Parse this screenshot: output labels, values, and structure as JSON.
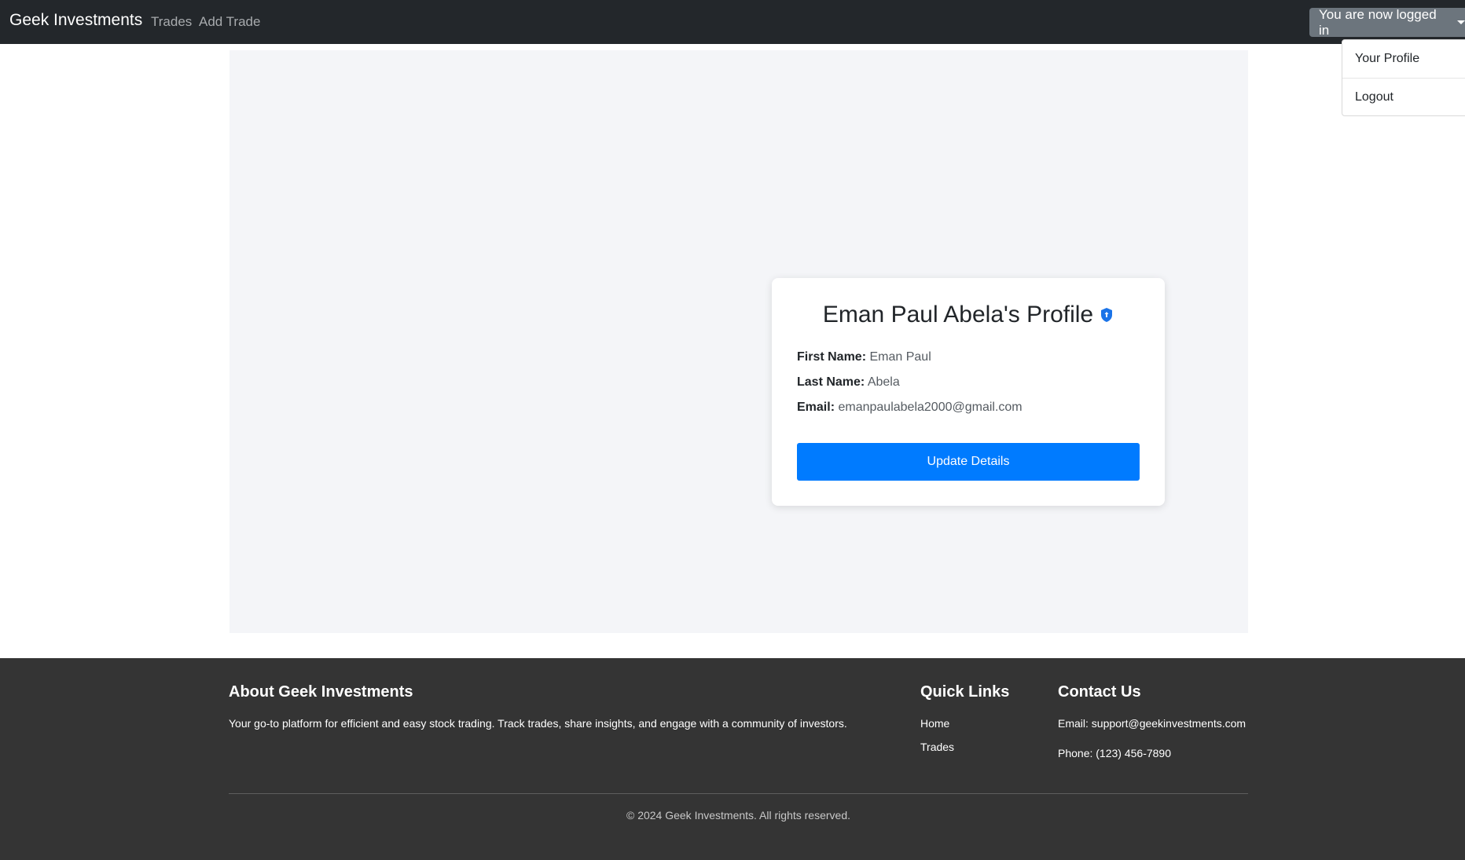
{
  "navbar": {
    "brand": "Geek Investments",
    "links": [
      {
        "label": "Trades"
      },
      {
        "label": "Add Trade"
      }
    ],
    "user_menu_label": "You are now logged in"
  },
  "dropdown": {
    "items": [
      {
        "label": "Your Profile"
      },
      {
        "label": "Logout"
      }
    ]
  },
  "profile": {
    "title": "Eman Paul Abela's Profile",
    "badge_icon": "shield-icon",
    "first_name_label": "First Name:",
    "first_name": "Eman Paul",
    "last_name_label": "Last Name:",
    "last_name": "Abela",
    "email_label": "Email:",
    "email": "emanpaulabela2000@gmail.com",
    "update_button": "Update Details"
  },
  "footer": {
    "about_heading": "About Geek Investments",
    "about_text": "Your go-to platform for efficient and easy stock trading. Track trades, share insights, and engage with a community of investors.",
    "quick_links_heading": "Quick Links",
    "quick_links": [
      {
        "label": "Home"
      },
      {
        "label": "Trades"
      }
    ],
    "contact_heading": "Contact Us",
    "contact_email": "Email: support@geekinvestments.com",
    "contact_phone": "Phone: (123) 456-7890",
    "copyright": "© 2024 Geek Investments. All rights reserved."
  },
  "colors": {
    "navbar_bg": "#23272b",
    "primary": "#007bff",
    "footer_bg": "#343434",
    "panel_bg": "#f4f5f8"
  }
}
